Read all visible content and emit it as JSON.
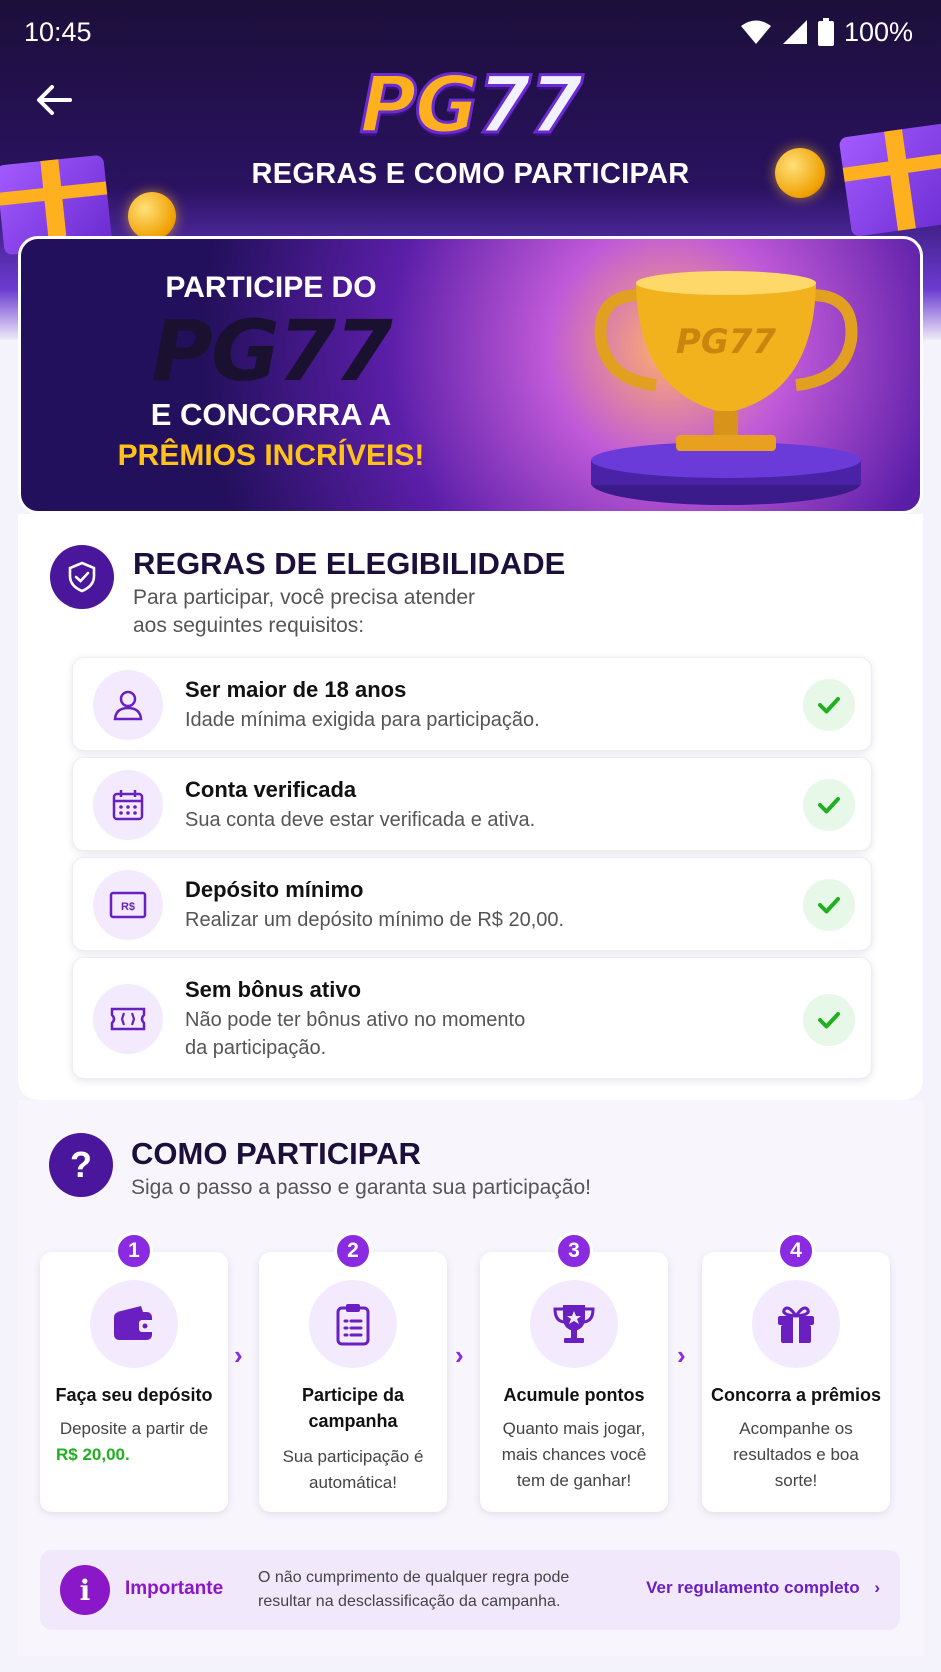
{
  "status_bar": {
    "time": "10:45",
    "battery": "100%"
  },
  "header": {
    "logo_pg": "PG",
    "logo_num": "77",
    "title": "REGRAS E COMO PARTICIPAR"
  },
  "banner": {
    "line1": "PARTICIPE DO",
    "logo_pg": "PG",
    "logo_num": "77",
    "line3": "E CONCORRA A",
    "line4": "PRÊMIOS INCRÍVEIS!",
    "trophy_text": "PG77"
  },
  "eligibility": {
    "title": "REGRAS DE ELEGIBILIDADE",
    "subtitle_1": "Para participar, você precisa atender",
    "subtitle_2": "aos seguintes requisitos:",
    "rules": [
      {
        "title": "Ser maior de 18 anos",
        "desc_1": "Idade mínima exigida para participação.",
        "desc_2": "",
        "icon": "user-icon"
      },
      {
        "title": "Conta verificada",
        "desc_1": "Sua conta deve estar verificada e ativa.",
        "desc_2": "",
        "icon": "calendar-icon"
      },
      {
        "title": "Depósito mínimo",
        "desc_1": "Realizar um depósito mínimo de R$ 20,00.",
        "desc_2": "",
        "icon": "money-icon",
        "icon_text": "R$"
      },
      {
        "title": "Sem bônus ativo",
        "desc_1": "Não pode ter bônus ativo no momento",
        "desc_2": "da participação.",
        "icon": "ticket-icon"
      }
    ]
  },
  "how_to": {
    "title": "COMO PARTICIPAR",
    "subtitle": "Siga o passo a passo e garanta sua participação!",
    "steps": [
      {
        "num": "1",
        "title": "Faça seu depósito",
        "desc_1": "Deposite a partir de",
        "desc_highlight": "R$ 20,00.",
        "icon": "wallet-icon"
      },
      {
        "num": "2",
        "title": "Participe da campanha",
        "desc": "Sua participação é automática!",
        "icon": "clipboard-icon"
      },
      {
        "num": "3",
        "title": "Acumule pontos",
        "desc": "Quanto mais jogar, mais chances você tem de ganhar!",
        "icon": "trophy-icon"
      },
      {
        "num": "4",
        "title": "Concorra a prêmios",
        "desc": "Acompanhe os resultados e boa sorte!",
        "icon": "gift-icon"
      }
    ]
  },
  "important": {
    "label": "Importante",
    "text": "O não cumprimento de qualquer regra pode resultar na desclassificação da campanha.",
    "link": "Ver regulamento completo",
    "icon_text": "i"
  },
  "colors": {
    "primary": "#4a169c",
    "accent": "#8a2be2",
    "gold": "#ffb01f",
    "success": "#22b022"
  }
}
